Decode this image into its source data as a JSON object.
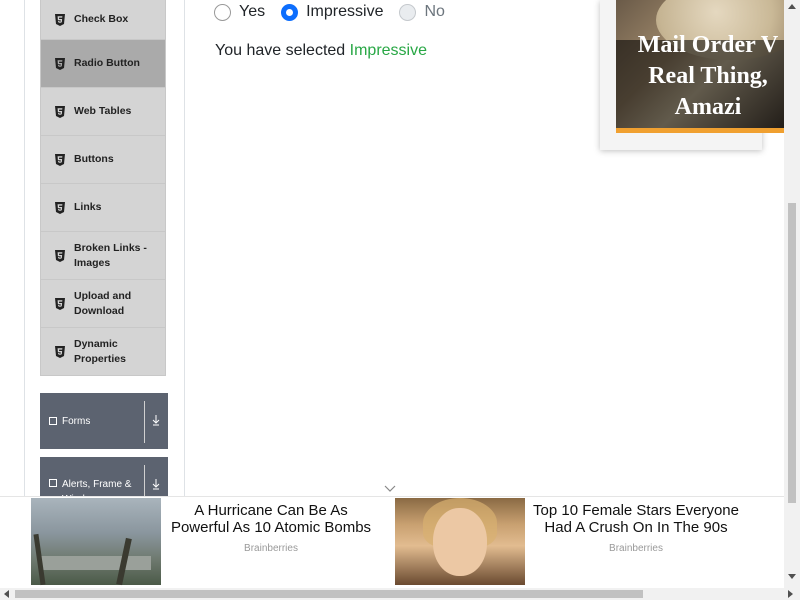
{
  "sidebar": {
    "items": [
      {
        "label": "Check Box",
        "active": false
      },
      {
        "label": "Radio Button",
        "active": true
      },
      {
        "label": "Web Tables",
        "active": false
      },
      {
        "label": "Buttons",
        "active": false
      },
      {
        "label": "Links",
        "active": false
      },
      {
        "label": "Broken Links - Images",
        "active": false
      },
      {
        "label": "Upload and Download",
        "active": false
      },
      {
        "label": "Dynamic Properties",
        "active": false
      }
    ],
    "groups": [
      {
        "label": "Forms",
        "icon": "form-icon"
      },
      {
        "label": "Alerts, Frame & Windows",
        "icon": "window-icon"
      }
    ]
  },
  "radio": {
    "options": [
      {
        "label": "Yes",
        "checked": false,
        "disabled": false
      },
      {
        "label": "Impressive",
        "checked": true,
        "disabled": false
      },
      {
        "label": "No",
        "checked": false,
        "disabled": true
      }
    ],
    "result_prefix": "You have selected",
    "result_value": "Impressive",
    "accent_color": "#0d6efd",
    "success_color": "#28a745"
  },
  "side_ad": {
    "headline_line1": "Mail Order V",
    "headline_line2": "Real Thing,",
    "headline_line3": "Amazi",
    "accent_color": "#f0a030"
  },
  "bottom_ads": [
    {
      "title_line1": "A Hurricane Can Be As",
      "title_line2": "Powerful As 10 Atomic Bombs",
      "source": "Brainberries"
    },
    {
      "title_line1": "Top 10 Female Stars Everyone",
      "title_line2": "Had A Crush On In The 90s",
      "source": "Brainberries"
    }
  ]
}
